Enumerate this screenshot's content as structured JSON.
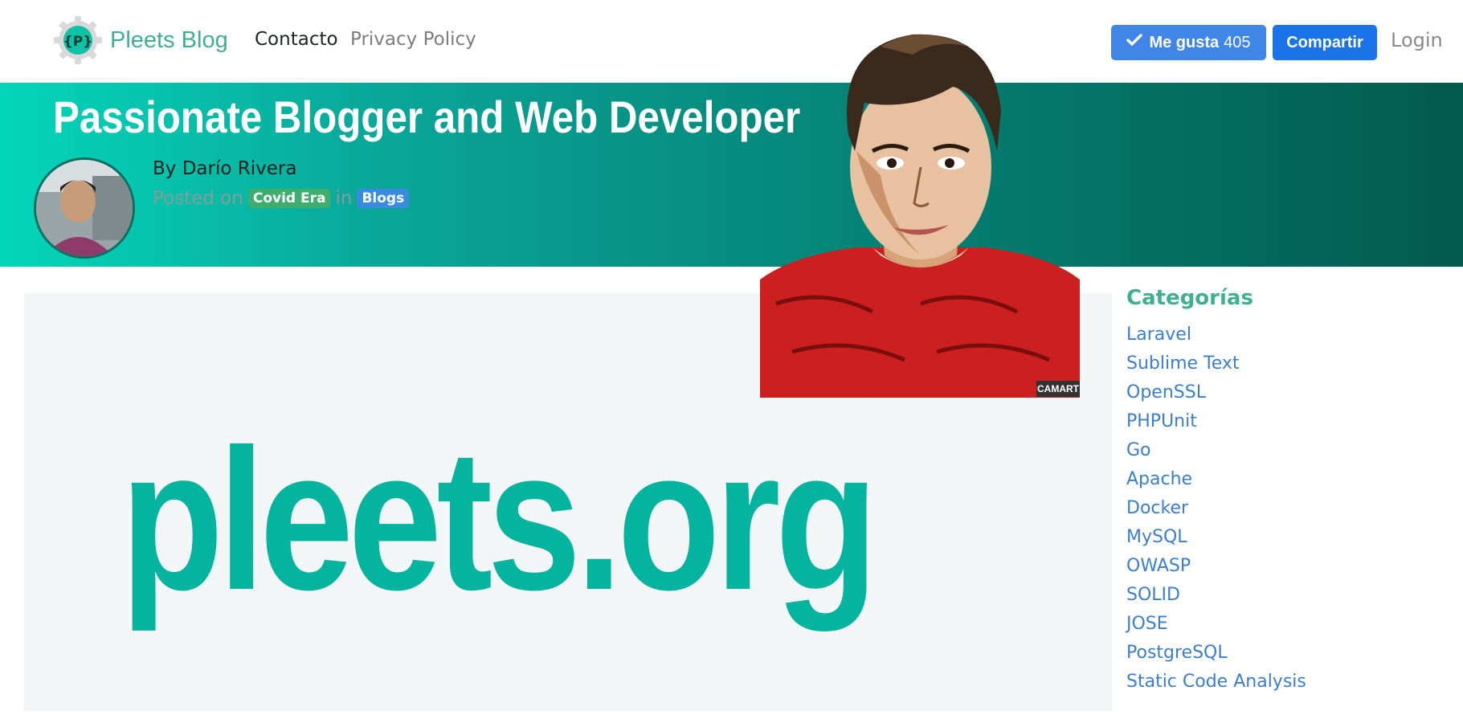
{
  "nav": {
    "brand_logo_text": "{P}",
    "brand": "Pleets Blog",
    "links": [
      "Contacto",
      "Privacy Policy"
    ],
    "like_label": "Me gusta",
    "like_count": "405",
    "share_label": "Compartir",
    "login": "Login"
  },
  "hero": {
    "title": "Passionate Blogger and Web Developer",
    "byline": "By Darío Rivera",
    "posted_on": "Posted on",
    "category": "Covid Era",
    "in": "in",
    "tag": "Blogs"
  },
  "main": {
    "image_text": "pleets.org",
    "cartoon_credit": "CAMART"
  },
  "sidebar": {
    "title": "Categorías",
    "categories": [
      "Laravel",
      "Sublime Text",
      "OpenSSL",
      "PHPUnit",
      "Go",
      "Apache",
      "Docker",
      "MySQL",
      "OWASP",
      "SOLID",
      "JOSE",
      "PostgreSQL",
      "Static Code Analysis"
    ]
  },
  "colors": {
    "brand": "#3eb08f",
    "hero_start": "#03d6b9",
    "hero_end": "#035a4f",
    "like_button": "#3f86e6",
    "share_button": "#1a73e8",
    "link": "#3a7ed0",
    "logo_text": "#05b49f"
  },
  "icons": {
    "brand": "gear-logo-icon",
    "like": "check-icon"
  }
}
